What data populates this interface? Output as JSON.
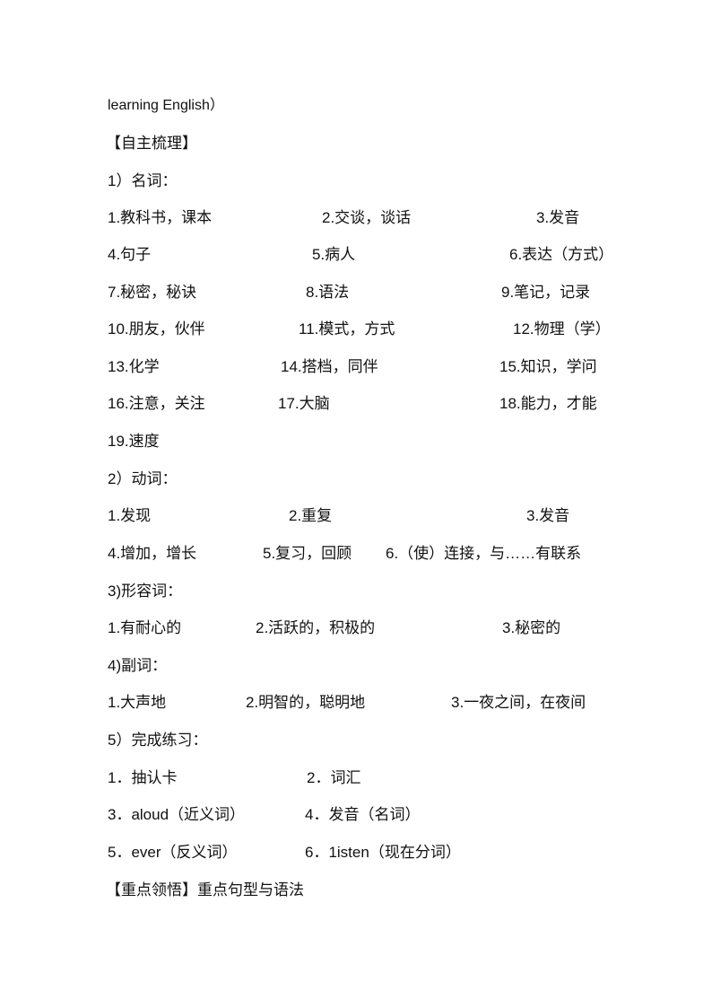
{
  "intro_line": "learning English）",
  "section_heading": "【自主梳理】",
  "nouns": {
    "heading": "1）名词：",
    "items": [
      "1.教科书，课本",
      "2.交谈，谈话",
      "3.发音",
      "4.句子",
      "5.病人",
      "6.表达（方式）",
      "7.秘密，秘诀",
      "8.语法",
      "9.笔记，记录",
      "10.朋友，伙伴",
      "11.模式，方式",
      "12.物理（学）",
      "13.化学",
      "14.搭档，同伴",
      "15.知识，学问",
      "16.注意，关注",
      "17.大脑",
      "18.能力，才能",
      "19.速度"
    ]
  },
  "verbs": {
    "heading": "2）动词：",
    "items": [
      "1.发现",
      "2.重复",
      "3.发音",
      "4.增加，增长",
      "5.复习，回顾",
      "6.（使）连接，与……有联系"
    ]
  },
  "adjectives": {
    "heading": "3)形容词：",
    "items": [
      "1.有耐心的",
      "2.活跃的，积极的",
      "3.秘密的"
    ]
  },
  "adverbs": {
    "heading": "4)副词：",
    "items": [
      "1.大声地",
      "2.明智的，聪明地",
      "3.一夜之间，在夜间"
    ]
  },
  "exercises": {
    "heading": "5）完成练习：",
    "items": [
      "1．抽认卡",
      "2．词汇",
      "3．aloud（近义词）",
      "4．发音（名词）",
      "5．ever（反义词）",
      "6．1isten（现在分词）"
    ]
  },
  "key_heading": "【重点领悟】重点句型与语法"
}
